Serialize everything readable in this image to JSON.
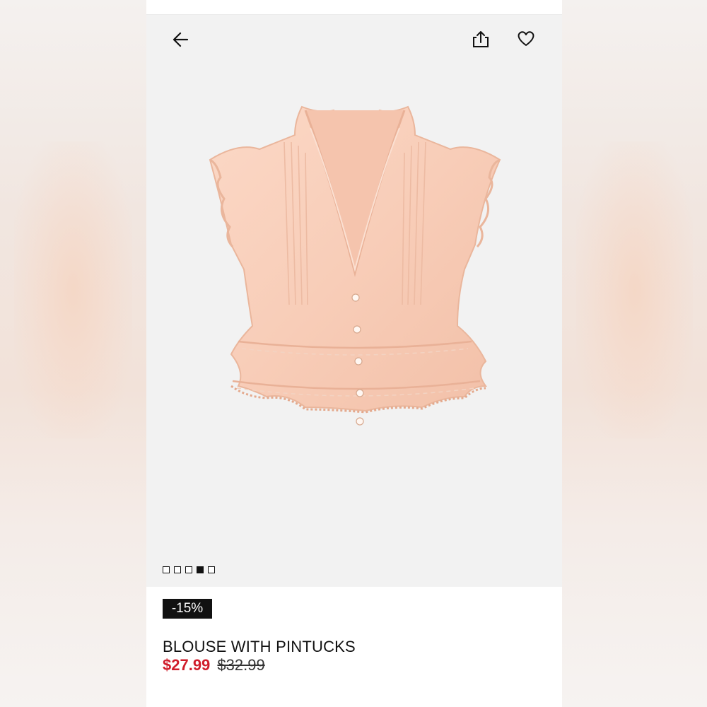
{
  "header": {
    "back_icon": "arrow-left-icon",
    "share_icon": "share-icon",
    "favorite_icon": "heart-icon"
  },
  "gallery": {
    "image_subject": "peach blouse",
    "image_count": 5,
    "active_index": 3
  },
  "product": {
    "discount_badge": "-15%",
    "name": "BLOUSE WITH PINTUCKS",
    "sale_price": "$27.99",
    "original_price": "$32.99"
  },
  "colors": {
    "sale": "#d01d2b",
    "badge_bg": "#111111",
    "product": "#f8cdb8"
  }
}
